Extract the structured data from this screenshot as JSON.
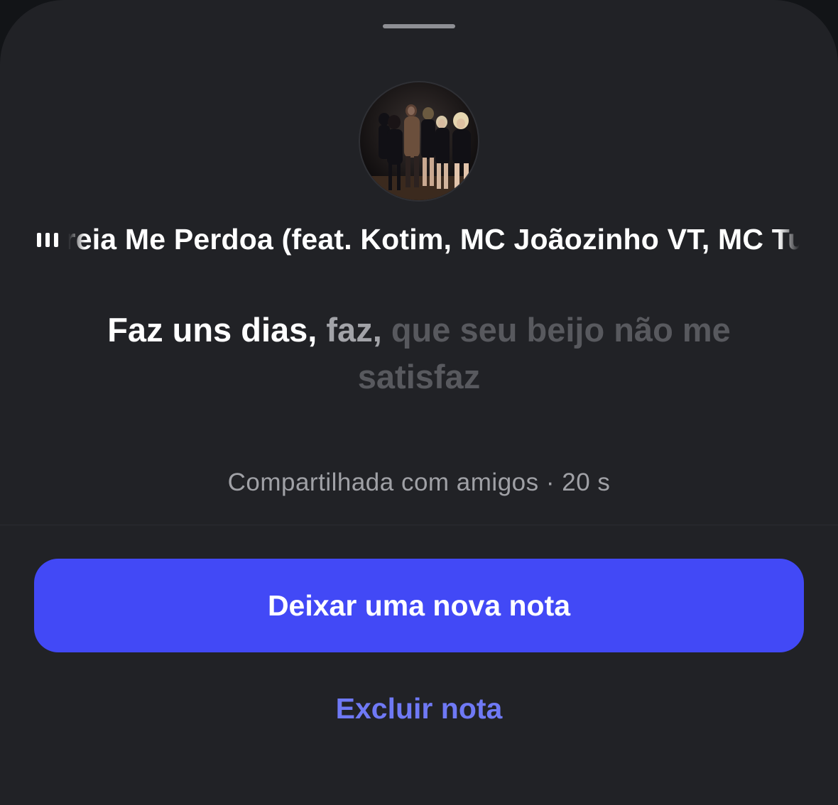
{
  "sheet": {
    "song": {
      "title": "Sereia Me Perdoa (feat. Kotim, MC Joãozinho VT, MC Tuto)",
      "icon": "audio-bars-icon"
    },
    "lyrics": {
      "sung": "Faz uns dias, ",
      "current": "faz, ",
      "upcoming": "que seu beijo não me satisfaz"
    },
    "shared_info": "Compartilhada com amigos · 20 s",
    "primary_action": "Deixar uma nova nota",
    "secondary_action": "Excluir nota"
  },
  "colors": {
    "sheet_background": "#212226",
    "primary_button": "#4249f6",
    "link": "#6f79f5"
  }
}
